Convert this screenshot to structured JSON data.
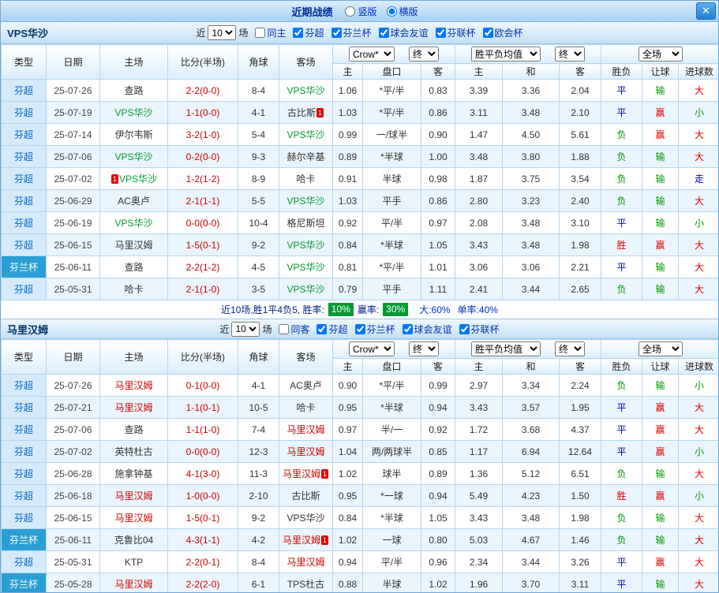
{
  "colors": {
    "highlight_green": "#009933",
    "highlight_red": "#cc0000",
    "cup_type_bg": "#2a9fd4",
    "league_type_bg": "#d5eafa",
    "league_type_text": "#0066cc",
    "score_text": "#cc0000",
    "win_red": "#e00000",
    "draw_blue": "#0000d0",
    "lose_green": "#009900",
    "rate_badge_bg": "#009933"
  },
  "titlebar": {
    "title": "近期战绩",
    "vertical_label": "竖版",
    "horizontal_label": "横版",
    "close_icon": "✕"
  },
  "controls": {
    "recent_label": "近",
    "matches_label": "场",
    "company": "Crow*",
    "final": "终",
    "avg": "胜平负均值",
    "fulltime": "全场"
  },
  "columns": {
    "type": "类型",
    "date": "日期",
    "home": "主场",
    "score": "比分(半场)",
    "corners": "角球",
    "away": "客场",
    "odds_home": "主",
    "odds_line": "盘口",
    "odds_away": "客",
    "avg_home": "主",
    "avg_draw": "和",
    "avg_away": "客",
    "result": "胜负",
    "handicap": "让球",
    "goals": "进球数"
  },
  "sections": [
    {
      "team": "VPS华沙",
      "highlight": "green",
      "recent_count": "10",
      "filters": [
        {
          "label": "同主",
          "checked": false
        },
        {
          "label": "芬超",
          "checked": true
        },
        {
          "label": "芬兰杯",
          "checked": true
        },
        {
          "label": "球会友谊",
          "checked": true
        },
        {
          "label": "芬联杯",
          "checked": true
        },
        {
          "label": "欧会杯",
          "checked": true
        }
      ],
      "matches": [
        {
          "type": "芬超",
          "cup": false,
          "date": "25-07-26",
          "home": "查路",
          "away": "VPS华沙",
          "score": "2-2(0-0)",
          "corners": "8-4",
          "odds": [
            "1.06",
            "*平/半",
            "0.83"
          ],
          "avg": [
            "3.39",
            "3.36",
            "2.04"
          ],
          "result": "平",
          "handicap": "输",
          "goals": "大"
        },
        {
          "type": "芬超",
          "cup": false,
          "date": "25-07-19",
          "home": "VPS华沙",
          "away": "古比斯",
          "away_card": "1",
          "score": "1-1(0-0)",
          "corners": "4-1",
          "odds": [
            "1.03",
            "*平/半",
            "0.86"
          ],
          "avg": [
            "3.11",
            "3.48",
            "2.10"
          ],
          "result": "平",
          "handicap": "赢",
          "goals": "小"
        },
        {
          "type": "芬超",
          "cup": false,
          "date": "25-07-14",
          "home": "伊尔韦斯",
          "away": "VPS华沙",
          "score": "3-2(1-0)",
          "corners": "5-4",
          "odds": [
            "0.99",
            "一/球半",
            "0.90"
          ],
          "avg": [
            "1.47",
            "4.50",
            "5.61"
          ],
          "result": "负",
          "handicap": "赢",
          "goals": "大"
        },
        {
          "type": "芬超",
          "cup": false,
          "date": "25-07-06",
          "home": "VPS华沙",
          "away": "赫尔辛基",
          "score": "0-2(0-0)",
          "corners": "9-3",
          "odds": [
            "0.89",
            "*半球",
            "1.00"
          ],
          "avg": [
            "3.48",
            "3.80",
            "1.88"
          ],
          "result": "负",
          "handicap": "输",
          "goals": "大"
        },
        {
          "type": "芬超",
          "cup": false,
          "date": "25-07-02",
          "home": "VPS华沙",
          "home_card": "1",
          "home_card_pos": "before",
          "away": "哈卡",
          "score": "1-2(1-2)",
          "corners": "8-9",
          "odds": [
            "0.91",
            "半球",
            "0.98"
          ],
          "avg": [
            "1.87",
            "3.75",
            "3.54"
          ],
          "result": "负",
          "handicap": "输",
          "goals": "走"
        },
        {
          "type": "芬超",
          "cup": false,
          "date": "25-06-29",
          "home": "AC奥卢",
          "away": "VPS华沙",
          "score": "2-1(1-1)",
          "corners": "5-5",
          "odds": [
            "1.03",
            "平手",
            "0.86"
          ],
          "avg": [
            "2.80",
            "3.23",
            "2.40"
          ],
          "result": "负",
          "handicap": "输",
          "goals": "大"
        },
        {
          "type": "芬超",
          "cup": false,
          "date": "25-06-19",
          "home": "VPS华沙",
          "away": "格尼斯坦",
          "score": "0-0(0-0)",
          "corners": "10-4",
          "odds": [
            "0.92",
            "平/半",
            "0.97"
          ],
          "avg": [
            "2.08",
            "3.48",
            "3.10"
          ],
          "result": "平",
          "handicap": "输",
          "goals": "小"
        },
        {
          "type": "芬超",
          "cup": false,
          "date": "25-06-15",
          "home": "马里汉姆",
          "away": "VPS华沙",
          "score": "1-5(0-1)",
          "corners": "9-2",
          "odds": [
            "0.84",
            "*半球",
            "1.05"
          ],
          "avg": [
            "3.43",
            "3.48",
            "1.98"
          ],
          "result": "胜",
          "handicap": "赢",
          "goals": "大"
        },
        {
          "type": "芬兰杯",
          "cup": true,
          "date": "25-06-11",
          "home": "查路",
          "away": "VPS华沙",
          "score": "2-2(1-2)",
          "corners": "4-5",
          "odds": [
            "0.81",
            "*平/半",
            "1.01"
          ],
          "avg": [
            "3.06",
            "3.06",
            "2.21"
          ],
          "result": "平",
          "handicap": "输",
          "goals": "大"
        },
        {
          "type": "芬超",
          "cup": false,
          "date": "25-05-31",
          "home": "哈卡",
          "away": "VPS华沙",
          "score": "2-1(1-0)",
          "corners": "3-5",
          "odds": [
            "0.79",
            "平手",
            "1.11"
          ],
          "avg": [
            "2.41",
            "3.44",
            "2.65"
          ],
          "result": "负",
          "handicap": "输",
          "goals": "大"
        }
      ],
      "summary": {
        "prefix": "近10场,胜1平4负5, 胜率:",
        "win_rate": "10%",
        "odds_label": "赢率:",
        "odds_rate": "30%",
        "big_text": "大:60%",
        "single_text": "单率:40%"
      }
    },
    {
      "team": "马里汉姆",
      "highlight": "red",
      "recent_count": "10",
      "filters": [
        {
          "label": "同客",
          "checked": false
        },
        {
          "label": "芬超",
          "checked": true
        },
        {
          "label": "芬兰杯",
          "checked": true
        },
        {
          "label": "球会友谊",
          "checked": true
        },
        {
          "label": "芬联杯",
          "checked": true
        }
      ],
      "matches": [
        {
          "type": "芬超",
          "cup": false,
          "date": "25-07-26",
          "home": "马里汉姆",
          "away": "AC奥卢",
          "score": "0-1(0-0)",
          "corners": "4-1",
          "odds": [
            "0.90",
            "*平/半",
            "0.99"
          ],
          "avg": [
            "2.97",
            "3.34",
            "2.24"
          ],
          "result": "负",
          "handicap": "输",
          "goals": "小"
        },
        {
          "type": "芬超",
          "cup": false,
          "date": "25-07-21",
          "home": "马里汉姆",
          "away": "哈卡",
          "score": "1-1(0-1)",
          "corners": "10-5",
          "odds": [
            "0.95",
            "*半球",
            "0.94"
          ],
          "avg": [
            "3.43",
            "3.57",
            "1.95"
          ],
          "result": "平",
          "handicap": "赢",
          "goals": "大"
        },
        {
          "type": "芬超",
          "cup": false,
          "date": "25-07-06",
          "home": "查路",
          "away": "马里汉姆",
          "score": "1-1(1-0)",
          "corners": "7-4",
          "odds": [
            "0.97",
            "半/一",
            "0.92"
          ],
          "avg": [
            "1.72",
            "3.68",
            "4.37"
          ],
          "result": "平",
          "handicap": "赢",
          "goals": "大"
        },
        {
          "type": "芬超",
          "cup": false,
          "date": "25-07-02",
          "home": "英特杜古",
          "away": "马里汉姆",
          "score": "0-0(0-0)",
          "corners": "12-3",
          "odds": [
            "1.04",
            "两/两球半",
            "0.85"
          ],
          "avg": [
            "1.17",
            "6.94",
            "12.64"
          ],
          "result": "平",
          "handicap": "赢",
          "goals": "小"
        },
        {
          "type": "芬超",
          "cup": false,
          "date": "25-06-28",
          "home": "施拿钟基",
          "away": "马里汉姆",
          "away_card": "1",
          "score": "4-1(3-0)",
          "corners": "11-3",
          "odds": [
            "1.02",
            "球半",
            "0.89"
          ],
          "avg": [
            "1.36",
            "5.12",
            "6.51"
          ],
          "result": "负",
          "handicap": "输",
          "goals": "大"
        },
        {
          "type": "芬超",
          "cup": false,
          "date": "25-06-18",
          "home": "马里汉姆",
          "away": "古比斯",
          "score": "1-0(0-0)",
          "corners": "2-10",
          "odds": [
            "0.95",
            "*一球",
            "0.94"
          ],
          "avg": [
            "5.49",
            "4.23",
            "1.50"
          ],
          "result": "胜",
          "handicap": "赢",
          "goals": "小"
        },
        {
          "type": "芬超",
          "cup": false,
          "date": "25-06-15",
          "home": "马里汉姆",
          "away": "VPS华沙",
          "score": "1-5(0-1)",
          "corners": "9-2",
          "odds": [
            "0.84",
            "*半球",
            "1.05"
          ],
          "avg": [
            "3.43",
            "3.48",
            "1.98"
          ],
          "result": "负",
          "handicap": "输",
          "goals": "大"
        },
        {
          "type": "芬兰杯",
          "cup": true,
          "date": "25-06-11",
          "home": "克鲁比04",
          "away": "马里汉姆",
          "away_card": "1",
          "score": "4-3(1-1)",
          "corners": "4-2",
          "odds": [
            "1.02",
            "一球",
            "0.80"
          ],
          "avg": [
            "5.03",
            "4.67",
            "1.46"
          ],
          "result": "负",
          "handicap": "输",
          "goals": "大"
        },
        {
          "type": "芬超",
          "cup": false,
          "date": "25-05-31",
          "home": "KTP",
          "away": "马里汉姆",
          "score": "2-2(0-1)",
          "corners": "8-4",
          "odds": [
            "0.94",
            "平/半",
            "0.96"
          ],
          "avg": [
            "2.34",
            "3.44",
            "3.26"
          ],
          "result": "平",
          "handicap": "赢",
          "goals": "大"
        },
        {
          "type": "芬兰杯",
          "cup": true,
          "date": "25-05-28",
          "home": "马里汉姆",
          "away": "TPS杜古",
          "score": "2-2(2-0)",
          "corners": "6-1",
          "odds": [
            "0.88",
            "半球",
            "1.02"
          ],
          "avg": [
            "1.96",
            "3.70",
            "3.11"
          ],
          "result": "平",
          "handicap": "输",
          "goals": "大"
        }
      ]
    }
  ]
}
